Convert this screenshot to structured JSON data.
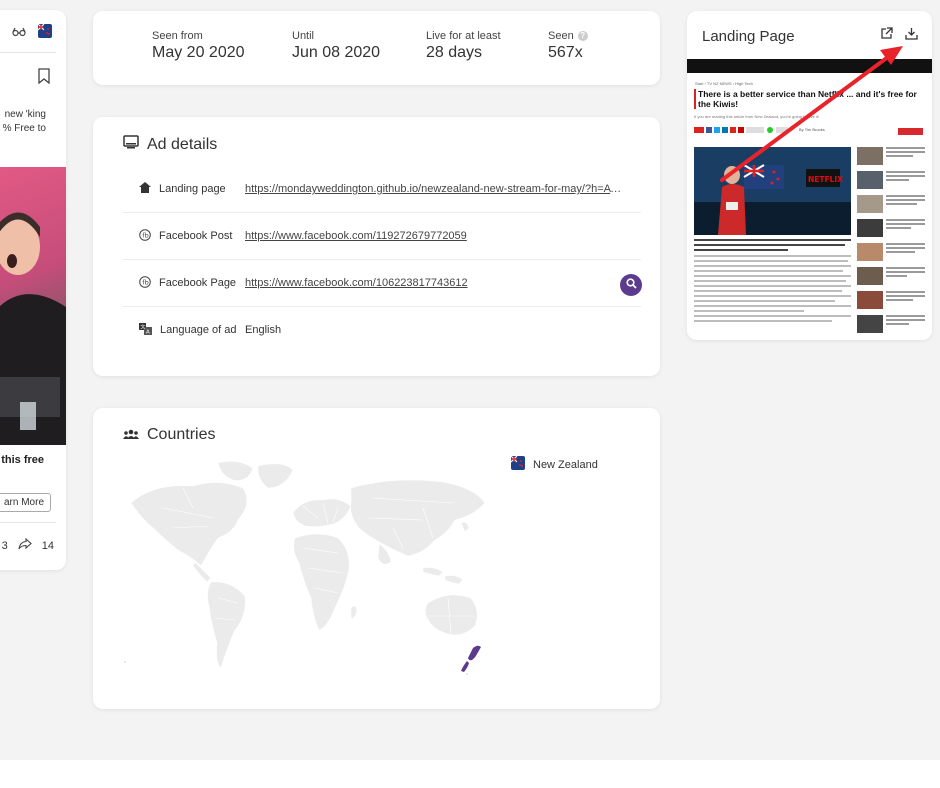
{
  "left_card": {
    "snippet_line1": "new 'king",
    "snippet_line2": "% Free to",
    "bold_snippet": "this free",
    "learn_more": "arn More",
    "comments_count": "3",
    "shares_count": "14"
  },
  "stats": {
    "seen_from_label": "Seen from",
    "seen_from_value": "May 20 2020",
    "until_label": "Until",
    "until_value": "Jun 08 2020",
    "live_label": "Live for at least",
    "live_value": "28 days",
    "seen_label": "Seen",
    "seen_value": "567x"
  },
  "ad_details": {
    "title": "Ad details",
    "rows": [
      {
        "label": "Landing page",
        "value": "https://mondayweddington.github.io/newzealand-new-stream-for-may/?h=AT2..."
      },
      {
        "label": "Facebook Post",
        "value": "https://www.facebook.com/119272679772059"
      },
      {
        "label": "Facebook Page",
        "value": "https://www.facebook.com/106223817743612"
      },
      {
        "label": "Language of ad",
        "value": "English"
      }
    ]
  },
  "countries": {
    "title": "Countries",
    "items": [
      {
        "name": "New Zealand"
      }
    ]
  },
  "landing_page": {
    "title": "Landing Page",
    "preview": {
      "crumbs": "Start  ›  TV NZ NEWS  ›  High Tech",
      "headline": "There is a better service than Netflix ... and it's free for the Kiwis!",
      "subline": "If you are reading this article from New Zealand, you're going to love it!",
      "byline": "By Tim Brooks",
      "image_logo": "NETFLIX"
    }
  },
  "colors": {
    "accent": "#5c3b8f",
    "arrow": "#e8232a",
    "page_bg": "#f3f3f4"
  }
}
